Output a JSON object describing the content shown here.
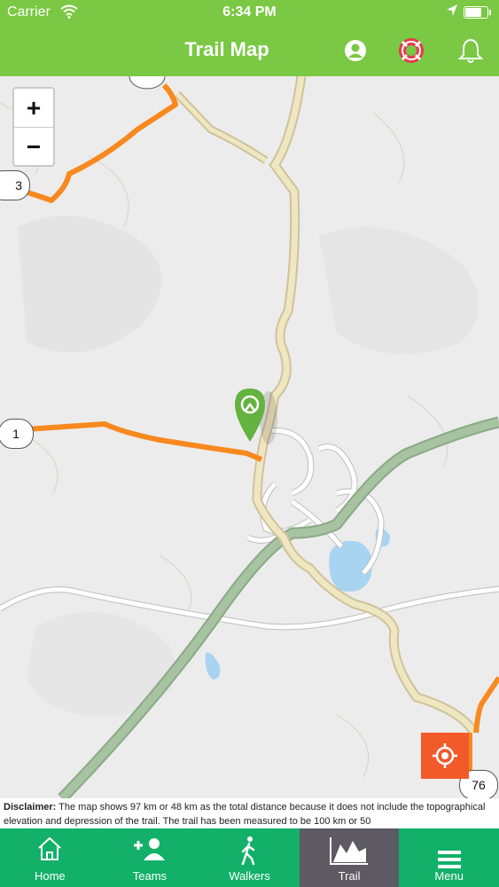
{
  "status_bar": {
    "carrier": "Carrier",
    "time": "6:34 PM"
  },
  "header": {
    "title": "Trail Map"
  },
  "map": {
    "zoom_in_label": "+",
    "zoom_out_label": "−",
    "markers": [
      "3",
      "1",
      "76"
    ]
  },
  "disclaimer": {
    "label": "Disclaimer:",
    "text": " The map shows 97 km or 48 km as the total distance because it does not include the topographical elevation and depression of the trail. The trail has been measured to be 100 km or 50"
  },
  "tabs": [
    {
      "label": "Home",
      "icon": "home-icon"
    },
    {
      "label": "Teams",
      "icon": "add-user-icon"
    },
    {
      "label": "Walkers",
      "icon": "walker-icon"
    },
    {
      "label": "Trail",
      "icon": "chart-icon",
      "active": true
    },
    {
      "label": "Menu",
      "icon": "menu-icon"
    }
  ],
  "colors": {
    "header": "#7ac843",
    "tabbar": "#12b068",
    "tab_active": "#5d5a63",
    "route": "#f7891f",
    "locate": "#f25a2a"
  }
}
